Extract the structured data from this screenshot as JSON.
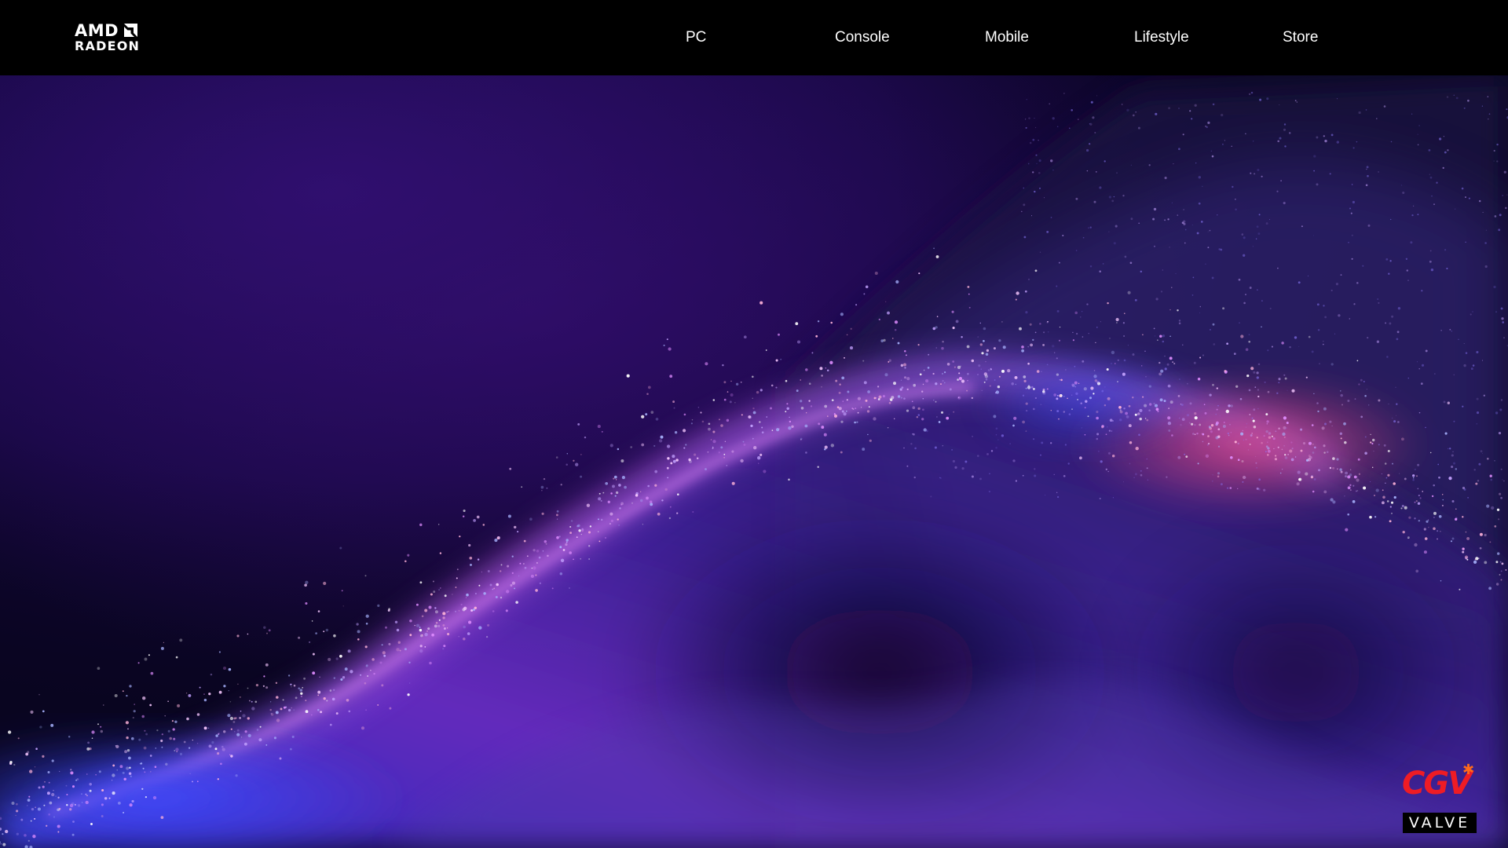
{
  "header": {
    "logo": {
      "brand": "AMD",
      "product": "RADEON"
    },
    "nav": [
      {
        "label": "PC"
      },
      {
        "label": "Console"
      },
      {
        "label": "Mobile"
      },
      {
        "label": "Lifestyle"
      },
      {
        "label": "Store"
      }
    ]
  },
  "hero": {
    "background_colors": {
      "deep": "#0c0626",
      "violet": "#5a2bd6",
      "magenta": "#d65ce8",
      "pink": "#ff5a8a",
      "blue": "#3a46ff"
    },
    "sponsors": {
      "cgv": "CGV",
      "valve": "VALVE",
      "cgv_color": "#ee1c25",
      "cgv_star_color": "#ff6a1a"
    }
  }
}
